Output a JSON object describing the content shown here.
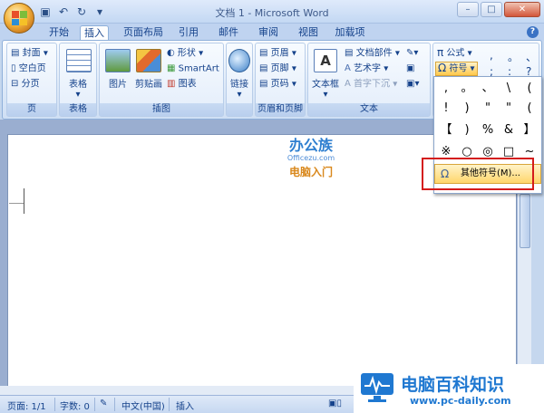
{
  "window": {
    "title": "文档 1 - Microsoft Word"
  },
  "qat": {
    "save_icon": "save-icon",
    "undo_icon": "undo-icon",
    "redo_icon": "redo-icon"
  },
  "tabs": [
    {
      "label": "开始"
    },
    {
      "label": "插入",
      "active": true
    },
    {
      "label": "页面布局"
    },
    {
      "label": "引用"
    },
    {
      "label": "邮件"
    },
    {
      "label": "审阅"
    },
    {
      "label": "视图"
    },
    {
      "label": "加载项"
    }
  ],
  "ribbon": {
    "pages": {
      "label": "页",
      "cover": "封面",
      "blank": "空白页",
      "break": "分页"
    },
    "tables": {
      "label": "表格",
      "table": "表格"
    },
    "illustrations": {
      "label": "插图",
      "picture": "图片",
      "clipart": "剪贴画",
      "shapes": "形状",
      "smartart": "SmartArt",
      "chart": "图表"
    },
    "links": {
      "label": "",
      "link": "链接"
    },
    "headerfooter": {
      "label": "页眉和页脚",
      "header": "页眉",
      "footer": "页脚",
      "pagenum": "页码"
    },
    "text": {
      "label": "文本",
      "textbox": "文本框",
      "quickparts": "文档部件",
      "wordart": "艺术字",
      "dropcap": "首字下沉"
    },
    "symbols": {
      "equation": "公式",
      "symbol": "符号"
    }
  },
  "symbol_menu": {
    "top_grid": [
      ",",
      "。",
      "、",
      ";",
      ":",
      "?"
    ],
    "rows": [
      [
        ",",
        "。",
        "、",
        "\\",
        "("
      ],
      [
        "!",
        ")",
        "\"",
        "\"",
        "("
      ],
      [
        "【",
        ")",
        "%",
        "&",
        "】"
      ],
      [
        "※",
        "○",
        "◎",
        "□",
        "~"
      ]
    ],
    "more_symbols": "其他符号(M)..."
  },
  "watermarks": {
    "center_title": "办公族",
    "center_sub": "Officezu.com",
    "center_tag": "电脑入门",
    "corner_title": "电脑百科知识",
    "corner_url": "www.pc-daily.com"
  },
  "status": {
    "page": "页面: 1/1",
    "words": "字数: 0",
    "language": "中文(中国)",
    "mode": "插入"
  },
  "colors": {
    "accent": "#15428b",
    "highlight": "#ffd66b",
    "red_box": "#d41b1b"
  }
}
